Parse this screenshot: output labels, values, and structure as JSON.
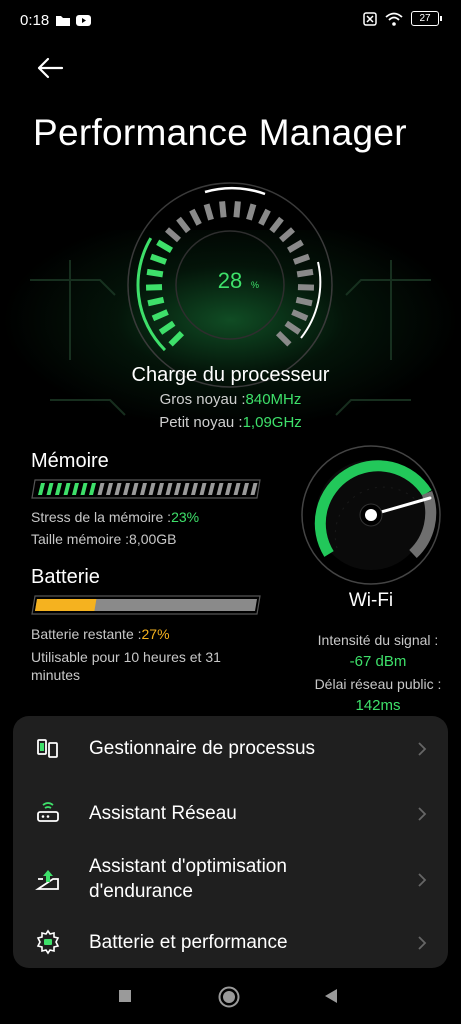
{
  "status_bar": {
    "time": "0:18",
    "battery": "27"
  },
  "header": {
    "title": "Performance Manager"
  },
  "cpu": {
    "percent": "28",
    "unit": "%",
    "label": "Charge du processeur",
    "big_core_label": "Gros noyau :",
    "big_core_value": "840MHz",
    "little_core_label": "Petit noyau :",
    "little_core_value": "1,09GHz",
    "load_fraction": 0.28
  },
  "memory": {
    "title": "Mémoire",
    "stress_label": "Stress de la mémoire :",
    "stress_value": "23%",
    "size_text": "Taille mémoire :8,00GB",
    "fill_fraction": 0.23
  },
  "battery": {
    "title": "Batterie",
    "remaining_label": "Batterie restante :",
    "remaining_value": "27%",
    "usable_line1": "Utilisable pour 10 heures et 31",
    "usable_line2": "minutes",
    "fill_fraction": 0.27
  },
  "wifi": {
    "title": "Wi-Fi",
    "signal_label": "Intensité du signal :",
    "signal_value": "-67 dBm",
    "delay_label": "Délai réseau public :",
    "delay_value": "142ms"
  },
  "menu": {
    "items": [
      {
        "label": "Gestionnaire de processus",
        "icon": "process-manager-icon"
      },
      {
        "label": "Assistant Réseau",
        "icon": "network-assistant-icon"
      },
      {
        "label_line1": "Assistant d'optimisation",
        "label_line2": "d'endurance",
        "icon": "endurance-optimization-icon"
      },
      {
        "label": "Batterie et performance",
        "icon": "battery-performance-icon"
      }
    ]
  },
  "colors": {
    "accent_green": "#3ee06a",
    "battery_orange": "#f5b21f",
    "card_bg": "#1f1f1f"
  }
}
